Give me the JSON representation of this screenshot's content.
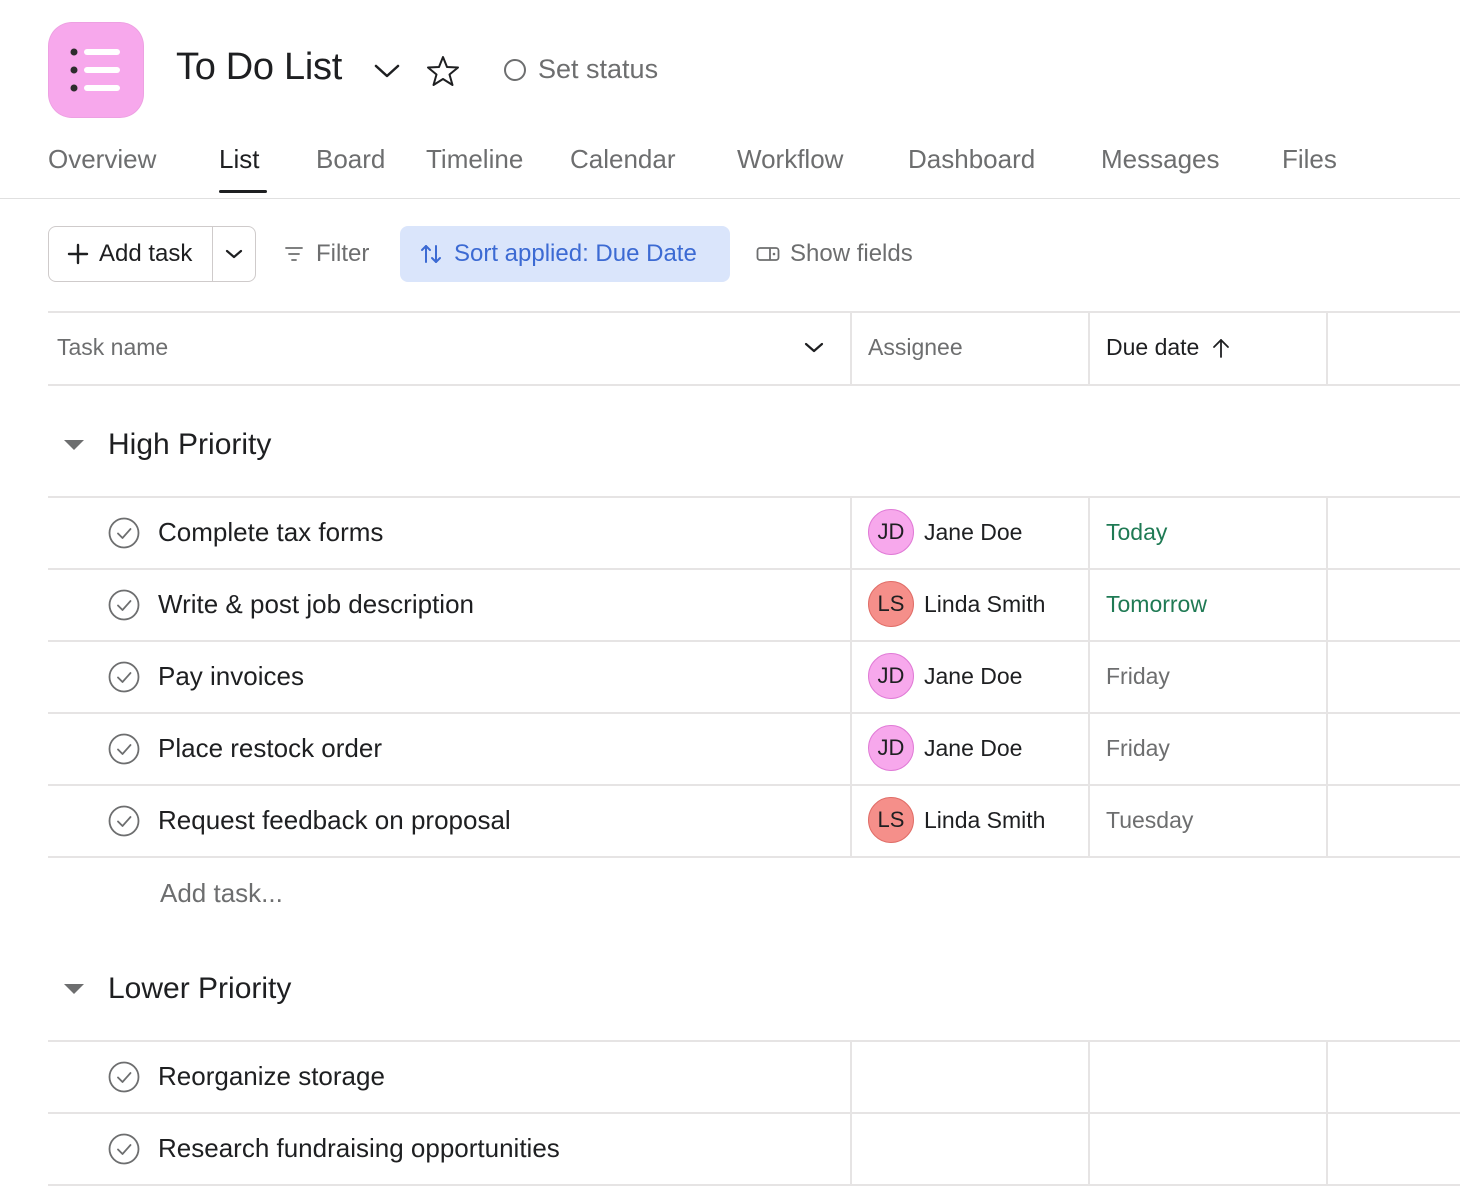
{
  "header": {
    "title": "To Do List",
    "status_label": "Set status",
    "icon_color": "#f7a8ec"
  },
  "tabs": [
    {
      "label": "Overview",
      "active": false
    },
    {
      "label": "List",
      "active": true
    },
    {
      "label": "Board",
      "active": false
    },
    {
      "label": "Timeline",
      "active": false
    },
    {
      "label": "Calendar",
      "active": false
    },
    {
      "label": "Workflow",
      "active": false
    },
    {
      "label": "Dashboard",
      "active": false
    },
    {
      "label": "Messages",
      "active": false
    },
    {
      "label": "Files",
      "active": false
    }
  ],
  "toolbar": {
    "add_task_label": "Add task",
    "filter_label": "Filter",
    "sort_label": "Sort applied: Due Date",
    "show_fields_label": "Show fields"
  },
  "columns": {
    "task_name": "Task name",
    "assignee": "Assignee",
    "due_date": "Due date"
  },
  "sections": [
    {
      "title": "High Priority",
      "tasks": [
        {
          "name": "Complete tax forms",
          "assignee": "Jane Doe",
          "initials": "JD",
          "avatar_color": "#f7a8ec",
          "due": "Today",
          "due_color": "#1f7a54"
        },
        {
          "name": "Write & post job description",
          "assignee": "Linda Smith",
          "initials": "LS",
          "avatar_color": "#f58f8a",
          "due": "Tomorrow",
          "due_color": "#1f7a54"
        },
        {
          "name": "Pay invoices",
          "assignee": "Jane Doe",
          "initials": "JD",
          "avatar_color": "#f7a8ec",
          "due": "Friday",
          "due_color": "#6d6e6f"
        },
        {
          "name": "Place restock order",
          "assignee": "Jane Doe",
          "initials": "JD",
          "avatar_color": "#f7a8ec",
          "due": "Friday",
          "due_color": "#6d6e6f"
        },
        {
          "name": "Request feedback on proposal",
          "assignee": "Linda Smith",
          "initials": "LS",
          "avatar_color": "#f58f8a",
          "due": "Tuesday",
          "due_color": "#6d6e6f"
        }
      ],
      "add_task_label": "Add task..."
    },
    {
      "title": "Lower Priority",
      "tasks": [
        {
          "name": "Reorganize storage"
        },
        {
          "name": "Research fundraising opportunities"
        }
      ]
    }
  ]
}
